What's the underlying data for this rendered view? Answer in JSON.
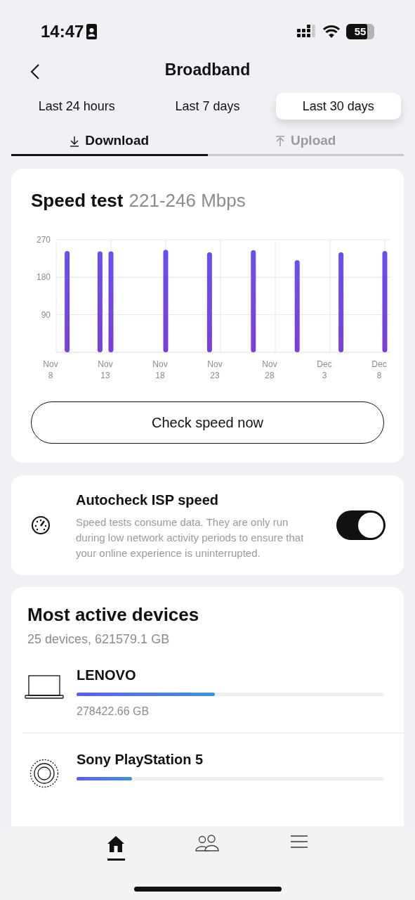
{
  "status_bar": {
    "time": "14:47",
    "battery": "55"
  },
  "header": {
    "title": "Broadband"
  },
  "periods": [
    {
      "label": "Last 24 hours",
      "selected": false
    },
    {
      "label": "Last 7 days",
      "selected": false
    },
    {
      "label": "Last 30 days",
      "selected": true
    }
  ],
  "directions": [
    {
      "label": "Download",
      "kind": "download",
      "selected": true
    },
    {
      "label": "Upload",
      "kind": "upload",
      "selected": false
    }
  ],
  "speed_test": {
    "title": "Speed test",
    "range": "221-246 Mbps",
    "button": "Check speed now",
    "chart_data": {
      "type": "bar",
      "categories": [
        "Nov 8",
        null,
        null,
        null,
        null,
        "Nov 13",
        null,
        null,
        null,
        null,
        "Nov 18",
        null,
        null,
        null,
        null,
        "Nov 23",
        null,
        null,
        null,
        null,
        "Nov 28",
        null,
        null,
        null,
        null,
        "Dec 3",
        null,
        null,
        null,
        null,
        "Dec 8"
      ],
      "series": [
        {
          "color": "#6a4ff0",
          "values": [
            null,
            243,
            null,
            null,
            242,
            242,
            null,
            null,
            null,
            null,
            246,
            null,
            null,
            null,
            240,
            null,
            null,
            null,
            245,
            null,
            null,
            null,
            221,
            null,
            null,
            null,
            240,
            null,
            null,
            null,
            243
          ]
        }
      ],
      "ylim": [
        0,
        270
      ],
      "yticks": [
        90,
        180,
        270
      ]
    }
  },
  "autocheck": {
    "title": "Autocheck ISP speed",
    "description": "Speed tests consume data. They are only run during low network activity periods to ensure that your online experience is uninterrupted.",
    "on": true
  },
  "devices": {
    "title": "Most active devices",
    "summary": "25 devices, 621579.1 GB",
    "items": [
      {
        "name": "LENOVO",
        "kind": "laptop",
        "level": 0.45,
        "usage": "278422.66 GB"
      },
      {
        "name": "Sony PlayStation 5",
        "kind": "console",
        "level": 0.18
      }
    ]
  },
  "nav": [
    {
      "kind": "home",
      "selected": true
    },
    {
      "kind": "people",
      "selected": false
    },
    {
      "kind": "menu",
      "selected": false
    }
  ]
}
